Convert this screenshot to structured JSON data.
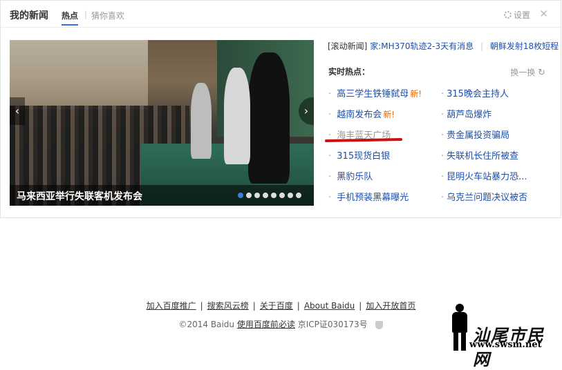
{
  "header": {
    "title": "我的新闻",
    "tabs": [
      {
        "label": "热点",
        "active": true
      },
      {
        "label": "猜你喜欢",
        "active": false
      }
    ],
    "tab_separator": "|",
    "settings_label": "设置",
    "close_glyph": "✕"
  },
  "slideshow": {
    "caption": "马来西亚举行失联客机发布会",
    "prev_glyph": "‹",
    "next_glyph": "›",
    "dot_count": 8,
    "active_dot": 1
  },
  "scroll_news": {
    "label": "[滚动新闻]",
    "items": [
      "家:MH370轨迹2-3天有消息",
      "朝鲜发射18枚短程"
    ],
    "separator": "|"
  },
  "hot": {
    "title": "实时热点：",
    "refresh_label": "换一换",
    "new_tag": "新!",
    "left": [
      {
        "text": "高三学生铁锤弑母",
        "is_new": true,
        "visited": false
      },
      {
        "text": "越南发布会",
        "is_new": true,
        "visited": false
      },
      {
        "text": "海丰蓝天广场",
        "is_new": false,
        "visited": true
      },
      {
        "text": "315现货白银",
        "is_new": false,
        "visited": false
      },
      {
        "text": "黑豹乐队",
        "is_new": false,
        "visited": false
      },
      {
        "text": "手机预装黑幕曝光",
        "is_new": false,
        "visited": false
      }
    ],
    "right": [
      {
        "text": "315晚会主持人"
      },
      {
        "text": "葫芦岛爆炸"
      },
      {
        "text": "贵金属投资骗局"
      },
      {
        "text": "失联机长住所被查"
      },
      {
        "text": "昆明火车站暴力恐..."
      },
      {
        "text": "乌克兰问题决议被否"
      }
    ]
  },
  "footer": {
    "links": [
      "加入百度推广",
      "搜索风云榜",
      "关于百度",
      "About Baidu",
      "加入开放首页"
    ],
    "separator": "|",
    "copyright": "©2014 Baidu",
    "terms_link": "使用百度前必读",
    "icp": "京ICP证030173号"
  },
  "watermark": {
    "text": "汕尾市民网",
    "url": "www.swsm.net"
  },
  "colors": {
    "link_blue": "#1e4fa8",
    "new_tag_orange": "#ee6600",
    "tab_underline": "#2f74d0",
    "annotation_red": "#cc1111"
  }
}
